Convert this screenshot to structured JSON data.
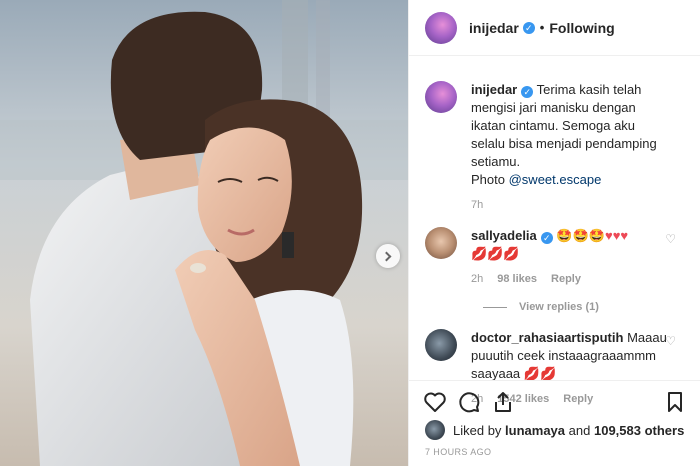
{
  "header": {
    "username": "inijedar",
    "verified_icon": "✓",
    "separator": "•",
    "follow_label": "Following"
  },
  "caption": {
    "username": "inijedar",
    "text": "Terima kasih telah mengisi jari manisku dengan ikatan cintamu. Semoga aku selalu bisa menjadi pendamping setiamu.",
    "photo_prefix": "Photo",
    "photo_credit": "@sweet.escape",
    "time": "7h"
  },
  "comments": [
    {
      "username": "sallyadelia",
      "verified": true,
      "emojis_smile": "🤩🤩🤩",
      "emojis_hearts": "♥♥♥",
      "emojis_lips": "💋💋💋",
      "time": "2h",
      "likes": "98 likes",
      "reply_label": "Reply",
      "view_replies": "View replies (1)"
    },
    {
      "username": "doctor_rahasiaartisputih",
      "verified": false,
      "text": "Maaau puuutih ceek instaaagraaammm saayaaa",
      "emojis_lips": "💋💋",
      "time": "2h",
      "likes": "1542 likes",
      "reply_label": "Reply"
    }
  ],
  "likes": {
    "prefix": "Liked by",
    "user": "lunamaya",
    "conjunction": "and",
    "count": "109,583 others"
  },
  "timestamp": "7 HOURS AGO",
  "icons": [
    "heart-outline-icon",
    "comment-icon",
    "share-icon",
    "bookmark-icon",
    "next-arrow-icon"
  ]
}
